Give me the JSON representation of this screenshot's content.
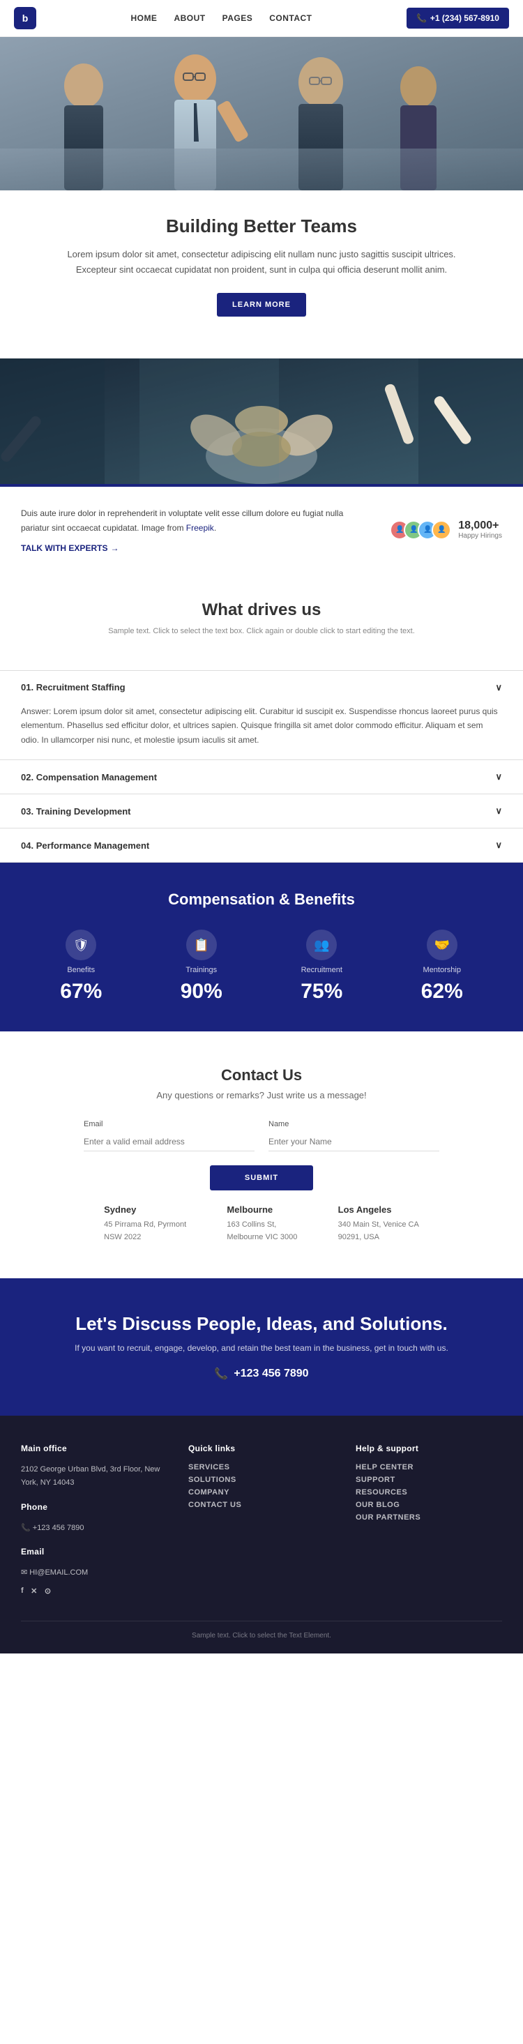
{
  "nav": {
    "logo_text": "b",
    "links": [
      {
        "label": "HOME",
        "href": "#"
      },
      {
        "label": "ABOUT",
        "href": "#"
      },
      {
        "label": "PAGES",
        "href": "#"
      },
      {
        "label": "CONTACT",
        "href": "#"
      }
    ],
    "cta_label": "+1 (234) 567-8910"
  },
  "hero": {
    "title": "Building Better Teams",
    "description": "Lorem ipsum dolor sit amet, consectetur adipiscing elit nullam nunc justo sagittis suscipit ultrices. Excepteur sint occaecat cupidatat non proident, sunt in culpa qui officia deserunt mollit anim.",
    "btn_label": "LEARN MORE"
  },
  "about": {
    "description": "Duis aute irure dolor in reprehenderit in voluptate velit esse cillum dolore eu fugiat nulla pariatur sint occaecat cupidatat. Image from Freepik.",
    "talk_label": "TALK WITH EXPERTS",
    "stats_number": "18,000+",
    "stats_label": "Happy Hirings"
  },
  "drives": {
    "title": "What drives us",
    "subtitle": "Sample text. Click to select the text box. Click again or double click to start editing the text.",
    "items": [
      {
        "number": "01.",
        "label": "Recruitment Staffing",
        "open": true,
        "answer": "Answer: Lorem ipsum dolor sit amet, consectetur adipiscing elit. Curabitur id suscipit ex. Suspendisse rhoncus laoreet purus quis elementum. Phasellus sed efficitur dolor, et ultrices sapien. Quisque fringilla sit amet dolor commodo efficitur. Aliquam et sem odio. In ullamcorper nisi nunc, et molestie ipsum iaculis sit amet."
      },
      {
        "number": "02.",
        "label": "Compensation Management",
        "open": false,
        "answer": ""
      },
      {
        "number": "03.",
        "label": "Training Development",
        "open": false,
        "answer": ""
      },
      {
        "number": "04.",
        "label": "Performance Management",
        "open": false,
        "answer": ""
      }
    ]
  },
  "compensation": {
    "title": "Compensation & Benefits",
    "stats": [
      {
        "icon": "🛡",
        "label": "Benefits",
        "value": "67%"
      },
      {
        "icon": "📋",
        "label": "Trainings",
        "value": "90%"
      },
      {
        "icon": "👥",
        "label": "Recruitment",
        "value": "75%"
      },
      {
        "icon": "🤝",
        "label": "Mentorship",
        "value": "62%"
      }
    ]
  },
  "contact": {
    "title": "Contact Us",
    "subtitle": "Any questions or remarks? Just write us a message!",
    "email_label": "Email",
    "email_placeholder": "Enter a valid email address",
    "name_label": "Name",
    "name_placeholder": "Enter your Name",
    "submit_label": "SUBMIT",
    "offices": [
      {
        "city": "Sydney",
        "address": "45 Pirrama Rd, Pyrmont\nNSW 2022"
      },
      {
        "city": "Melbourne",
        "address": "163 Collins St,\nMelbourne VIC 3000"
      },
      {
        "city": "Los Angeles",
        "address": "340 Main St, Venice CA\n90291, USA"
      }
    ]
  },
  "cta": {
    "title": "Let's Discuss People, Ideas, and Solutions.",
    "subtitle": "If you want to recruit, engage, develop, and retain the best team in the business, get in touch with us.",
    "phone": "+123 456 7890"
  },
  "footer": {
    "main_office_label": "Main office",
    "main_office_address": "2102 George Urban Blvd, 3rd Floor, New York, NY 14043",
    "phone_label": "Phone",
    "phone": "+123 456 7890",
    "email_label": "Email",
    "email": "HI@EMAIL.COM",
    "quick_links_label": "Quick links",
    "quick_links": [
      {
        "label": "SERVICES"
      },
      {
        "label": "SOLUTIONS"
      },
      {
        "label": "COMPANY"
      },
      {
        "label": "CONTACT US"
      }
    ],
    "help_label": "Help & support",
    "help_links": [
      {
        "label": "HELP CENTER"
      },
      {
        "label": "SUPPORT"
      },
      {
        "label": "RESOURCES"
      },
      {
        "label": "OUR BLOG"
      },
      {
        "label": "OUR PARTNERS"
      }
    ],
    "sample_text": "Sample text. Click to select the Text Element."
  }
}
